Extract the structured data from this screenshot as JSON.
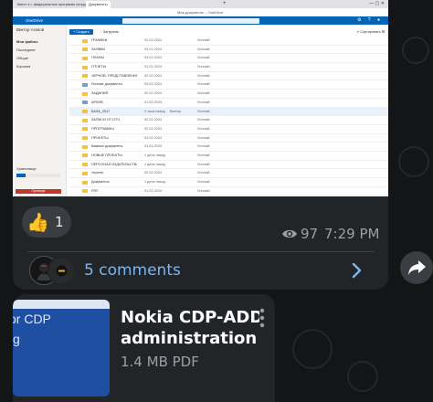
{
  "colors": {
    "background": "#131517",
    "bubble": "#222528",
    "accent_link": "#7fb4ea",
    "muted_text": "#9aa0a6",
    "onedrive_blue": "#0364b8",
    "doc_thumb_blue": "#1e4fa3"
  },
  "post": {
    "reaction": {
      "emoji": "👍",
      "count": "1"
    },
    "views": "97",
    "time": "7:29 PM",
    "comments_label": "5 comments",
    "icons": {
      "views": "eye-icon",
      "comments": "chevron-right-icon",
      "share": "share-icon"
    }
  },
  "screenshot": {
    "tabs": [
      "Квест к г. федеральных программ сотрудника",
      "Документы"
    ],
    "window_title": "Мои документы – OneDrive",
    "app_name": "OneDrive",
    "nav": {
      "user": "Виктор Агапов",
      "items": [
        "Мои файлы",
        "Последние",
        "Общие",
        "Корзина"
      ],
      "footer_label": "Хранилище",
      "cta_label": "Премиум"
    },
    "toolbar": {
      "new_label": "+ Создать",
      "upload_label": "↑ Загрузить",
      "right_label": "≡ Сортировать ⊞"
    },
    "rows": [
      {
        "name": "ГРАФИКИ",
        "modified": "02.02.2024",
        "by": "",
        "sharing": "Личный",
        "type": "folder"
      },
      {
        "name": "ЗАЯВКИ",
        "modified": "03.01.2024",
        "by": "",
        "sharing": "Личный",
        "type": "folder"
      },
      {
        "name": "ПЛАНЫ",
        "modified": "04.01.2024",
        "by": "",
        "sharing": "Личный",
        "type": "folder"
      },
      {
        "name": "ОТЧЕТЫ",
        "modified": "01.02.2024",
        "by": "",
        "sharing": "Личный",
        "type": "folder"
      },
      {
        "name": "ЧЕРНОВ. ПРЕДСТАВЛЕНИЯ",
        "modified": "02.02.2024",
        "by": "",
        "sharing": "Личный",
        "type": "folder"
      },
      {
        "name": "Личные документы",
        "modified": "04.02.2024",
        "by": "",
        "sharing": "Личный",
        "type": "doc"
      },
      {
        "name": "ЗАДАНИЯ",
        "modified": "02.02.2024",
        "by": "",
        "sharing": "Личный",
        "type": "folder"
      },
      {
        "name": "АРХИВ",
        "modified": "01.02.2024",
        "by": "",
        "sharing": "Личный",
        "type": "doc"
      },
      {
        "name": "БАЗА_2017",
        "modified": "2 часа назад",
        "by": "Виктор",
        "sharing": "Личный",
        "type": "folder",
        "selected": true
      },
      {
        "name": "ЗАПИСИ ОТ ОТЧ.",
        "modified": "02.02.2024",
        "by": "",
        "sharing": "Личный",
        "type": "folder"
      },
      {
        "name": "ПРОГРАММЫ",
        "modified": "02.02.2024",
        "by": "",
        "sharing": "Личный",
        "type": "folder"
      },
      {
        "name": "ПРОЕКТЫ",
        "modified": "04.02.2024",
        "by": "",
        "sharing": "Личный",
        "type": "folder"
      },
      {
        "name": "Важные документы",
        "modified": "01.01.2024",
        "by": "",
        "sharing": "Личный",
        "type": "folder"
      },
      {
        "name": "НОВЫЕ ПРОЕКТЫ",
        "modified": "1 день назад",
        "by": "",
        "sharing": "Личный",
        "type": "folder"
      },
      {
        "name": "ПЕРСОНАЛ ИЗДАТЕЛЬСТВА",
        "modified": "1 день назад",
        "by": "",
        "sharing": "Личный",
        "type": "folder"
      },
      {
        "name": "Чертеж",
        "modified": "02.02.2024",
        "by": "",
        "sharing": "Личный",
        "type": "folder"
      },
      {
        "name": "Документы",
        "modified": "1 день назад",
        "by": "",
        "sharing": "Личный",
        "type": "folder"
      },
      {
        "name": "PDF",
        "modified": "01.02.2024",
        "by": "",
        "sharing": "Личный",
        "type": "folder"
      },
      {
        "name": "Отчеты_общие",
        "modified": "1 день назад",
        "by": "",
        "sharing": "Личный",
        "type": "folder"
      },
      {
        "name": "Видео",
        "modified": "02.02.2024",
        "by": "",
        "sharing": "Личный",
        "type": "folder"
      },
      {
        "name": "ВЕБ ЭФИР_СЕРИЯ",
        "modified": "02.02.2024",
        "by": "",
        "sharing": "Личный",
        "type": "folder"
      },
      {
        "name": "ИЗОБРАЖЕНИЯ",
        "modified": "04.02.2024",
        "by": "",
        "sharing": "Личный",
        "type": "folder"
      }
    ]
  },
  "document": {
    "thumb_text_1": "or CDP",
    "thumb_text_2": "g",
    "title_line_1": "Nokia CDP-ADD",
    "title_line_2": "administration ...",
    "meta": "1.4 MB PDF"
  }
}
